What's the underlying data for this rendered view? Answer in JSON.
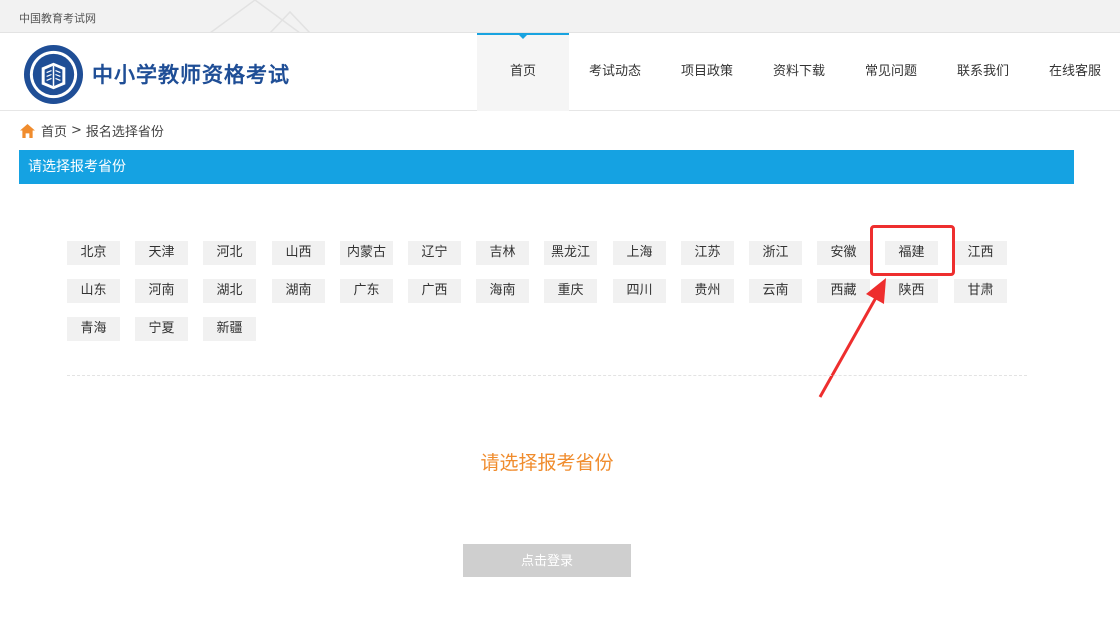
{
  "topbar": {
    "site_name": "中国教育考试网"
  },
  "header": {
    "brand_title": "中小学教师资格考试"
  },
  "nav": {
    "items": [
      {
        "label": "首页",
        "active": true
      },
      {
        "label": "考试动态"
      },
      {
        "label": "项目政策"
      },
      {
        "label": "资料下载"
      },
      {
        "label": "常见问题"
      },
      {
        "label": "联系我们"
      },
      {
        "label": "在线客服"
      }
    ]
  },
  "breadcrumb": {
    "home": "首页",
    "separator": ">",
    "current": "报名选择省份"
  },
  "section": {
    "title": "请选择报考省份"
  },
  "provinces": [
    "北京",
    "天津",
    "河北",
    "山西",
    "内蒙古",
    "辽宁",
    "吉林",
    "黑龙江",
    "上海",
    "江苏",
    "浙江",
    "安徽",
    "福建",
    "江西",
    "山东",
    "河南",
    "湖北",
    "湖南",
    "广东",
    "广西",
    "海南",
    "重庆",
    "四川",
    "贵州",
    "云南",
    "西藏",
    "陕西",
    "甘肃",
    "青海",
    "宁夏",
    "新疆"
  ],
  "highlighted_province": "福建",
  "prompt": "请选择报考省份",
  "login_button": "点击登录",
  "colors": {
    "accent": "#15a2e2",
    "brand": "#1f4e96",
    "prompt": "#f08c2d",
    "highlight": "#ee2e2e"
  }
}
